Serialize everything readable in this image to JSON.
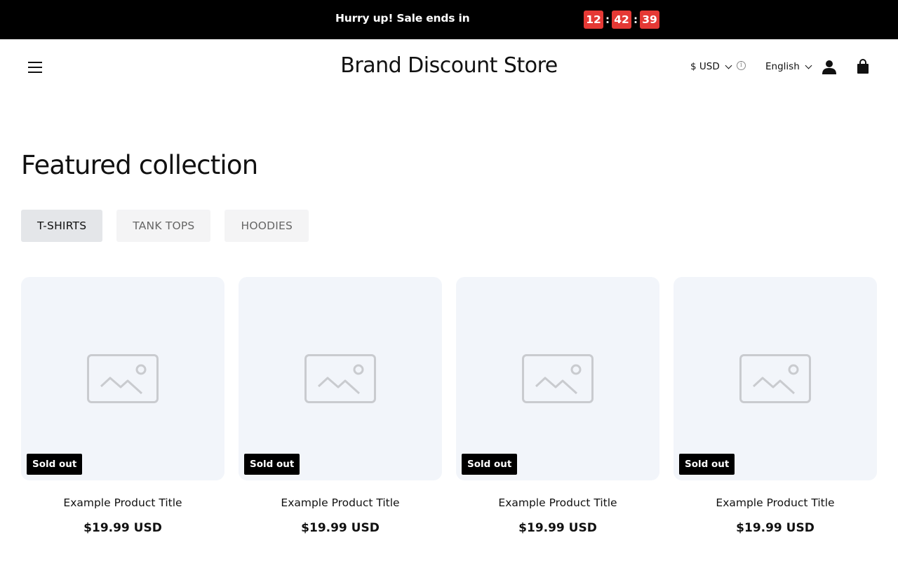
{
  "announcement": {
    "text": "Hurry up! Sale ends in",
    "countdown": {
      "hours": "12",
      "minutes": "42",
      "seconds": "39",
      "separator": ":"
    },
    "accent_color": "#e53935"
  },
  "header": {
    "brand": "Brand Discount Store",
    "currency": "$ USD",
    "language": "English"
  },
  "section": {
    "title": "Featured collection",
    "tabs": [
      {
        "label": "T-SHIRTS",
        "active": true
      },
      {
        "label": "TANK TOPS",
        "active": false
      },
      {
        "label": "HOODIES",
        "active": false
      }
    ]
  },
  "products": [
    {
      "title": "Example Product Title",
      "price": "$19.99 USD",
      "badge": "Sold out"
    },
    {
      "title": "Example Product Title",
      "price": "$19.99 USD",
      "badge": "Sold out"
    },
    {
      "title": "Example Product Title",
      "price": "$19.99 USD",
      "badge": "Sold out"
    },
    {
      "title": "Example Product Title",
      "price": "$19.99 USD",
      "badge": "Sold out"
    }
  ]
}
